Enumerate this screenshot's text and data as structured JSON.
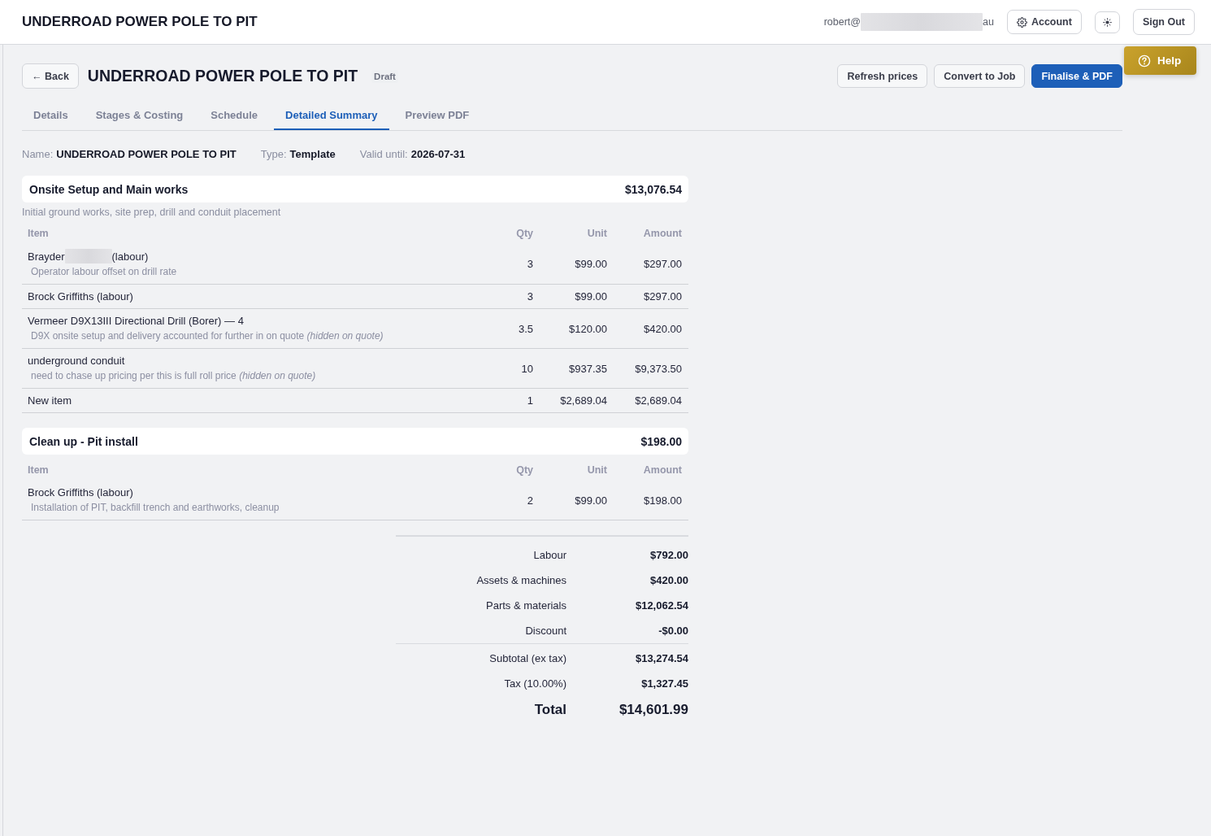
{
  "header": {
    "title": "UNDERROAD POWER POLE TO PIT",
    "user": {
      "email_start": "robert@",
      "redacted": true,
      "email_end": "au"
    },
    "buttons": [
      {
        "kind": "account",
        "label": "Account"
      },
      {
        "kind": "theme"
      },
      {
        "kind": "signout",
        "label": "Sign Out"
      }
    ]
  },
  "help_button": {
    "label": "Help"
  },
  "quote": {
    "back_label": "← Back",
    "title": "UNDERROAD POWER POLE TO PIT",
    "status": "Draft",
    "actions": [
      {
        "label": "Refresh prices",
        "primary": false
      },
      {
        "label": "Convert to Job",
        "primary": false
      },
      {
        "label": "Finalise & PDF",
        "primary": true
      }
    ]
  },
  "tabs": [
    {
      "label": "Details",
      "selected": false
    },
    {
      "label": "Stages & Costing",
      "selected": false
    },
    {
      "label": "Schedule",
      "selected": false
    },
    {
      "label": "Detailed Summary",
      "selected": true
    },
    {
      "label": "Preview PDF",
      "selected": false
    }
  ],
  "meta": [
    {
      "label": "Name:",
      "value": "UNDERROAD POWER POLE TO PIT"
    },
    {
      "label": "Type:",
      "value": "Template"
    },
    {
      "label": "Valid until:",
      "value": "2026-07-31"
    }
  ],
  "sections": [
    {
      "title": "Onsite Setup and Main works",
      "total": "$13,076.54",
      "description": "Initial ground works, site prep, drill and conduit placement",
      "columns": [
        "Item",
        "Qty",
        "Unit",
        "Amount"
      ],
      "rows": [
        {
          "name": "Brayder",
          "redacted": true,
          "name_end": "(labour)",
          "note": "Operator labour offset on drill rate",
          "qty": "3",
          "unit": "$99.00",
          "amount": "$297.00"
        },
        {
          "name": "Brock Griffiths (labour)",
          "redacted": false,
          "qty": "3",
          "unit": "$99.00",
          "amount": "$297.00"
        },
        {
          "name": "Vermeer D9X13III Directional Drill (Borer) — 4",
          "redacted": false,
          "note": "D9X onsite setup and delivery accounted for further in on quote *(hidden on quote)*",
          "qty": "3.5",
          "unit": "$120.00",
          "amount": "$420.00"
        },
        {
          "name": "underground conduit",
          "redacted": false,
          "note": "need to chase up pricing per this is full roll price *(hidden on quote)*",
          "qty": "10",
          "unit": "$937.35",
          "amount": "$9,373.50"
        },
        {
          "name": "New item",
          "redacted": false,
          "qty": "1",
          "unit": "$2,689.04",
          "amount": "$2,689.04"
        }
      ]
    },
    {
      "title": "Clean up - Pit install",
      "total": "$198.00",
      "columns": [
        "Item",
        "Qty",
        "Unit",
        "Amount"
      ],
      "rows": [
        {
          "name": "Brock Griffiths (labour)",
          "redacted": false,
          "note": "Installation of PIT, backfill trench and earthworks, cleanup",
          "qty": "2",
          "unit": "$99.00",
          "amount": "$198.00"
        }
      ]
    }
  ],
  "totals": {
    "groups": [
      {
        "rows": [
          {
            "label": "Labour",
            "value": "$792.00"
          },
          {
            "label": "Assets & machines",
            "value": "$420.00"
          },
          {
            "label": "Parts & materials",
            "value": "$12,062.54"
          },
          {
            "label": "Discount",
            "value": "-$0.00"
          }
        ]
      },
      {
        "rows": [
          {
            "label": "Subtotal (ex tax)",
            "value": "$13,274.54"
          },
          {
            "label": "Tax (10.00%)",
            "value": "$1,327.45"
          }
        ]
      }
    ],
    "total": {
      "label": "Total",
      "value": "$14,601.99"
    }
  }
}
